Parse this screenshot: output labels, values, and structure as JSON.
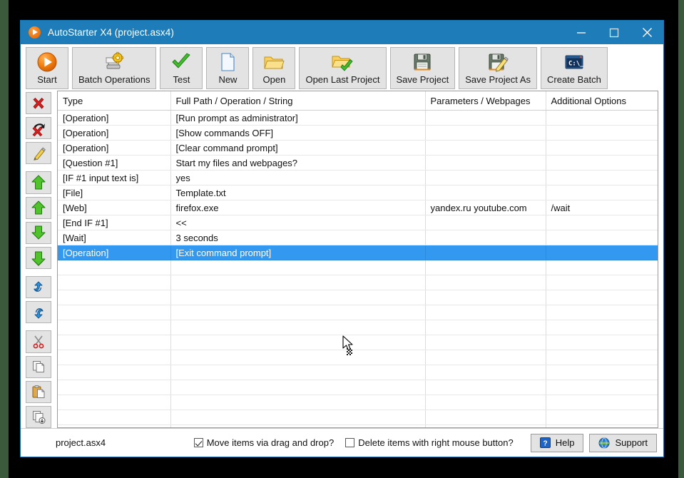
{
  "window": {
    "title": "AutoStarter X4 (project.asx4)",
    "icon": "play-circle-icon",
    "accent_color": "#1e7cb8",
    "controls": [
      {
        "name": "minimize",
        "glyph": "minimize-icon"
      },
      {
        "name": "maximize",
        "glyph": "maximize-icon"
      },
      {
        "name": "close",
        "glyph": "close-icon"
      }
    ]
  },
  "toolbar": {
    "buttons": [
      {
        "label": "Start",
        "icon": "play-circle-icon"
      },
      {
        "label": "Batch Operations",
        "icon": "batch-gear-icon"
      },
      {
        "label": "Test",
        "icon": "green-check-icon"
      },
      {
        "label": "New",
        "icon": "new-document-icon"
      },
      {
        "label": "Open",
        "icon": "open-folder-icon"
      },
      {
        "label": "Open Last Project",
        "icon": "folder-check-icon"
      },
      {
        "label": "Save Project",
        "icon": "floppy-disk-icon"
      },
      {
        "label": "Save Project As",
        "icon": "floppy-pencil-icon"
      },
      {
        "label": "Create Batch",
        "icon": "command-prompt-icon"
      }
    ]
  },
  "sidebar": {
    "buttons": [
      {
        "name": "delete-item",
        "icon": "red-x-icon"
      },
      {
        "name": "delete-all-items",
        "icon": "red-x-arrow-icon"
      },
      {
        "name": "edit-item",
        "icon": "pencil-icon"
      },
      {
        "name": "move-to-top",
        "icon": "green-up-double-icon"
      },
      {
        "name": "move-up",
        "icon": "green-up-icon"
      },
      {
        "name": "move-down",
        "icon": "green-down-icon"
      },
      {
        "name": "move-to-bottom",
        "icon": "green-down-double-icon"
      },
      {
        "name": "undo",
        "icon": "blue-undo-icon"
      },
      {
        "name": "redo",
        "icon": "blue-redo-icon"
      },
      {
        "name": "cut",
        "icon": "scissors-icon"
      },
      {
        "name": "copy",
        "icon": "copy-pages-icon"
      },
      {
        "name": "paste",
        "icon": "clipboard-paste-icon"
      },
      {
        "name": "duplicate",
        "icon": "duplicate-icon"
      }
    ]
  },
  "grid": {
    "columns": [
      "Type",
      "Full Path / Operation / String",
      "Parameters / Webpages",
      "Additional Options"
    ],
    "rows": [
      {
        "type": "[Operation]",
        "path": "[Run prompt as administrator]",
        "params": "",
        "options": "",
        "selected": false
      },
      {
        "type": "[Operation]",
        "path": "[Show commands OFF]",
        "params": "",
        "options": "",
        "selected": false
      },
      {
        "type": "[Operation]",
        "path": "[Clear command prompt]",
        "params": "",
        "options": "",
        "selected": false
      },
      {
        "type": "[Question #1]",
        "path": "Start my files and webpages?",
        "params": "",
        "options": "",
        "selected": false
      },
      {
        "type": "[IF #1 input text is]",
        "path": "yes",
        "params": "",
        "options": "",
        "selected": false
      },
      {
        "type": "[File]",
        "path": "Template.txt",
        "params": "",
        "options": "",
        "selected": false
      },
      {
        "type": "[Web]",
        "path": "firefox.exe",
        "params": "yandex.ru youtube.com",
        "options": "/wait",
        "selected": false
      },
      {
        "type": "[End IF #1]",
        "path": "<<",
        "params": "",
        "options": "",
        "selected": false
      },
      {
        "type": "[Wait]",
        "path": "3 seconds",
        "params": "",
        "options": "",
        "selected": false
      },
      {
        "type": "[Operation]",
        "path": "[Exit command prompt]",
        "params": "",
        "options": "",
        "selected": true
      },
      {
        "type": "",
        "path": "",
        "params": "",
        "options": "",
        "selected": false
      },
      {
        "type": "",
        "path": "",
        "params": "",
        "options": "",
        "selected": false
      },
      {
        "type": "",
        "path": "",
        "params": "",
        "options": "",
        "selected": false
      },
      {
        "type": "",
        "path": "",
        "params": "",
        "options": "",
        "selected": false
      },
      {
        "type": "",
        "path": "",
        "params": "",
        "options": "",
        "selected": false
      },
      {
        "type": "",
        "path": "",
        "params": "",
        "options": "",
        "selected": false
      },
      {
        "type": "",
        "path": "",
        "params": "",
        "options": "",
        "selected": false
      },
      {
        "type": "",
        "path": "",
        "params": "",
        "options": "",
        "selected": false
      },
      {
        "type": "",
        "path": "",
        "params": "",
        "options": "",
        "selected": false
      },
      {
        "type": "",
        "path": "",
        "params": "",
        "options": "",
        "selected": false
      },
      {
        "type": "",
        "path": "",
        "params": "",
        "options": "",
        "selected": false
      },
      {
        "type": "",
        "path": "",
        "params": "",
        "options": "",
        "selected": false
      }
    ],
    "selection_color": "#3399f0"
  },
  "statusbar": {
    "file_name": "project.asx4",
    "move_items_label": "Move items via drag and drop?",
    "move_items_checked": true,
    "delete_items_label": "Delete items with right mouse button?",
    "delete_items_checked": false,
    "help_label": "Help",
    "help_icon": "help-question-icon",
    "support_label": "Support",
    "support_icon": "globe-icon"
  }
}
